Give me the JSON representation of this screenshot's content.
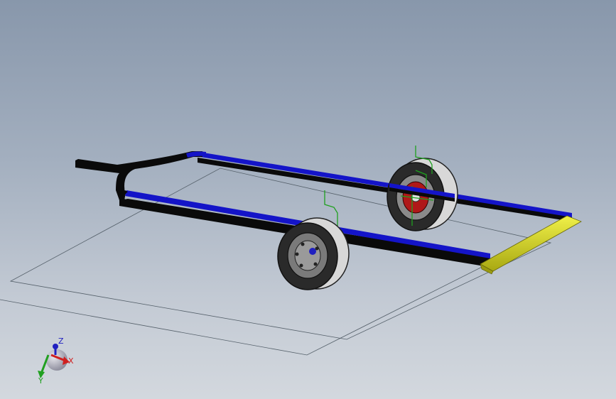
{
  "colors": {
    "rail_blue": "#1414c8",
    "rail_black": "#0a0a0a",
    "bumper_yellow": "#d4d41e",
    "tire_gray": "#d8d8d8",
    "hub_red": "#b01818",
    "sketch_green": "#1ea01e",
    "triad_x": "#d02020",
    "triad_y": "#20a020",
    "triad_z": "#2020c0"
  },
  "triad": {
    "x_label": "X",
    "y_label": "Y",
    "z_label": "Z"
  }
}
